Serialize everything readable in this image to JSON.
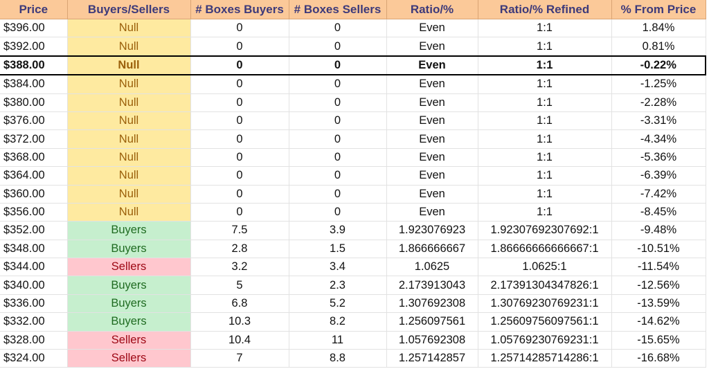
{
  "columns": [
    "Price",
    "Buyers/Sellers",
    "# Boxes Buyers",
    "# Boxes Sellers",
    "Ratio/%",
    "Ratio/% Refined",
    "% From Price"
  ],
  "rows": [
    {
      "price": "$396.00",
      "side": "Null",
      "boxes_buyers": "0",
      "boxes_sellers": "0",
      "ratio": "Even",
      "ratio_refined": "1:1",
      "pct_from_price": "1.84%"
    },
    {
      "price": "$392.00",
      "side": "Null",
      "boxes_buyers": "0",
      "boxes_sellers": "0",
      "ratio": "Even",
      "ratio_refined": "1:1",
      "pct_from_price": "0.81%"
    },
    {
      "price": "$388.00",
      "side": "Null",
      "boxes_buyers": "0",
      "boxes_sellers": "0",
      "ratio": "Even",
      "ratio_refined": "1:1",
      "pct_from_price": "-0.22%",
      "current": true
    },
    {
      "price": "$384.00",
      "side": "Null",
      "boxes_buyers": "0",
      "boxes_sellers": "0",
      "ratio": "Even",
      "ratio_refined": "1:1",
      "pct_from_price": "-1.25%"
    },
    {
      "price": "$380.00",
      "side": "Null",
      "boxes_buyers": "0",
      "boxes_sellers": "0",
      "ratio": "Even",
      "ratio_refined": "1:1",
      "pct_from_price": "-2.28%"
    },
    {
      "price": "$376.00",
      "side": "Null",
      "boxes_buyers": "0",
      "boxes_sellers": "0",
      "ratio": "Even",
      "ratio_refined": "1:1",
      "pct_from_price": "-3.31%"
    },
    {
      "price": "$372.00",
      "side": "Null",
      "boxes_buyers": "0",
      "boxes_sellers": "0",
      "ratio": "Even",
      "ratio_refined": "1:1",
      "pct_from_price": "-4.34%"
    },
    {
      "price": "$368.00",
      "side": "Null",
      "boxes_buyers": "0",
      "boxes_sellers": "0",
      "ratio": "Even",
      "ratio_refined": "1:1",
      "pct_from_price": "-5.36%"
    },
    {
      "price": "$364.00",
      "side": "Null",
      "boxes_buyers": "0",
      "boxes_sellers": "0",
      "ratio": "Even",
      "ratio_refined": "1:1",
      "pct_from_price": "-6.39%"
    },
    {
      "price": "$360.00",
      "side": "Null",
      "boxes_buyers": "0",
      "boxes_sellers": "0",
      "ratio": "Even",
      "ratio_refined": "1:1",
      "pct_from_price": "-7.42%"
    },
    {
      "price": "$356.00",
      "side": "Null",
      "boxes_buyers": "0",
      "boxes_sellers": "0",
      "ratio": "Even",
      "ratio_refined": "1:1",
      "pct_from_price": "-8.45%"
    },
    {
      "price": "$352.00",
      "side": "Buyers",
      "boxes_buyers": "7.5",
      "boxes_sellers": "3.9",
      "ratio": "1.923076923",
      "ratio_refined": "1.92307692307692:1",
      "pct_from_price": "-9.48%"
    },
    {
      "price": "$348.00",
      "side": "Buyers",
      "boxes_buyers": "2.8",
      "boxes_sellers": "1.5",
      "ratio": "1.866666667",
      "ratio_refined": "1.86666666666667:1",
      "pct_from_price": "-10.51%"
    },
    {
      "price": "$344.00",
      "side": "Sellers",
      "boxes_buyers": "3.2",
      "boxes_sellers": "3.4",
      "ratio": "1.0625",
      "ratio_refined": "1.0625:1",
      "pct_from_price": "-11.54%"
    },
    {
      "price": "$340.00",
      "side": "Buyers",
      "boxes_buyers": "5",
      "boxes_sellers": "2.3",
      "ratio": "2.173913043",
      "ratio_refined": "2.17391304347826:1",
      "pct_from_price": "-12.56%"
    },
    {
      "price": "$336.00",
      "side": "Buyers",
      "boxes_buyers": "6.8",
      "boxes_sellers": "5.2",
      "ratio": "1.307692308",
      "ratio_refined": "1.30769230769231:1",
      "pct_from_price": "-13.59%"
    },
    {
      "price": "$332.00",
      "side": "Buyers",
      "boxes_buyers": "10.3",
      "boxes_sellers": "8.2",
      "ratio": "1.256097561",
      "ratio_refined": "1.25609756097561:1",
      "pct_from_price": "-14.62%"
    },
    {
      "price": "$328.00",
      "side": "Sellers",
      "boxes_buyers": "10.4",
      "boxes_sellers": "11",
      "ratio": "1.057692308",
      "ratio_refined": "1.05769230769231:1",
      "pct_from_price": "-15.65%"
    },
    {
      "price": "$324.00",
      "side": "Sellers",
      "boxes_buyers": "7",
      "boxes_sellers": "8.8",
      "ratio": "1.257142857",
      "ratio_refined": "1.25714285714286:1",
      "pct_from_price": "-16.68%"
    }
  ],
  "colors": {
    "header_bg": "#fbc999",
    "header_text": "#3d3a7a",
    "null_bg": "#feeaa0",
    "null_text": "#9a5f0a",
    "buyers_bg": "#c6efce",
    "buyers_text": "#1f6b21",
    "sellers_bg": "#ffc7ce",
    "sellers_text": "#9c0613"
  }
}
